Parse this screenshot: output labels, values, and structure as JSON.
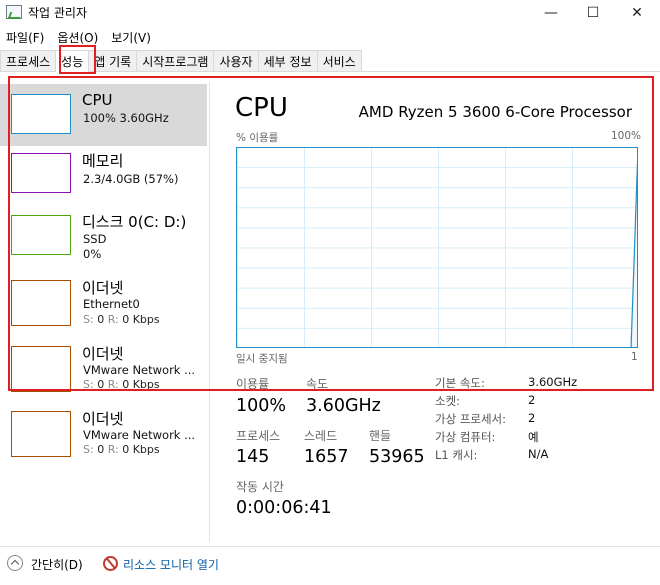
{
  "window": {
    "title": "작업 관리자",
    "minimize_glyph": "—",
    "maximize_glyph": "☐",
    "close_glyph": "✕"
  },
  "menu": [
    "파일(F)",
    "옵션(O)",
    "보기(V)"
  ],
  "tabs": [
    "프로세스",
    "성능",
    "앱 기록",
    "시작프로그램",
    "사용자",
    "세부 정보",
    "서비스"
  ],
  "active_tab": "성능",
  "sidebar": {
    "cpu": {
      "title": "CPU",
      "line1": "100% 3.60GHz",
      "color": "#1e8fc7"
    },
    "memory": {
      "title": "메모리",
      "line1": "2.3/4.0GB (57%)",
      "color": "#8b12ae"
    },
    "disk": {
      "title": "디스크 0(C: D:)",
      "line1": "SSD",
      "line2": "0%",
      "color": "#4da60c"
    },
    "eth1": {
      "title": "이더넷",
      "line1": "Ethernet0",
      "s_label": "S:",
      "s_val": "0",
      "r_label": "R:",
      "r_val": "0 Kbps",
      "color": "#a74f01"
    },
    "eth2": {
      "title": "이더넷",
      "line1": "VMware Network ...",
      "s_label": "S:",
      "s_val": "0",
      "r_label": "R:",
      "r_val": "0 Kbps",
      "color": "#a74f01"
    },
    "eth3": {
      "title": "이더넷",
      "line1": "VMware Network ...",
      "s_label": "S:",
      "s_val": "0",
      "r_label": "R:",
      "r_val": "0 Kbps",
      "color": "#a74f01"
    }
  },
  "main": {
    "title": "CPU",
    "processor": "AMD Ryzen 5 3600 6-Core Processor",
    "graph_top_left": "% 이용률",
    "graph_top_right": "100%",
    "graph_bottom_left": "일시 중지됨",
    "graph_bottom_right": "1",
    "utilization_series": [
      0,
      100
    ]
  },
  "stats": {
    "util_label": "이용률",
    "util_value": "100%",
    "speed_label": "속도",
    "speed_value": "3.60GHz",
    "proc_label": "프로세스",
    "proc_value": "145",
    "thread_label": "스레드",
    "thread_value": "1657",
    "handle_label": "핸들",
    "handle_value": "53965",
    "uptime_label": "작동 시간",
    "uptime_value": "0:00:06:41"
  },
  "details": [
    {
      "label": "기본 속도:",
      "value": "3.60GHz"
    },
    {
      "label": "소켓:",
      "value": "2"
    },
    {
      "label": "가상 프로세서:",
      "value": "2"
    },
    {
      "label": "가상 컴퓨터:",
      "value": "예"
    },
    {
      "label": "L1 캐시:",
      "value": "N/A"
    }
  ],
  "footer": {
    "fewer_details": "간단히(D)",
    "resource_monitor": "리소스 모니터 열기"
  }
}
